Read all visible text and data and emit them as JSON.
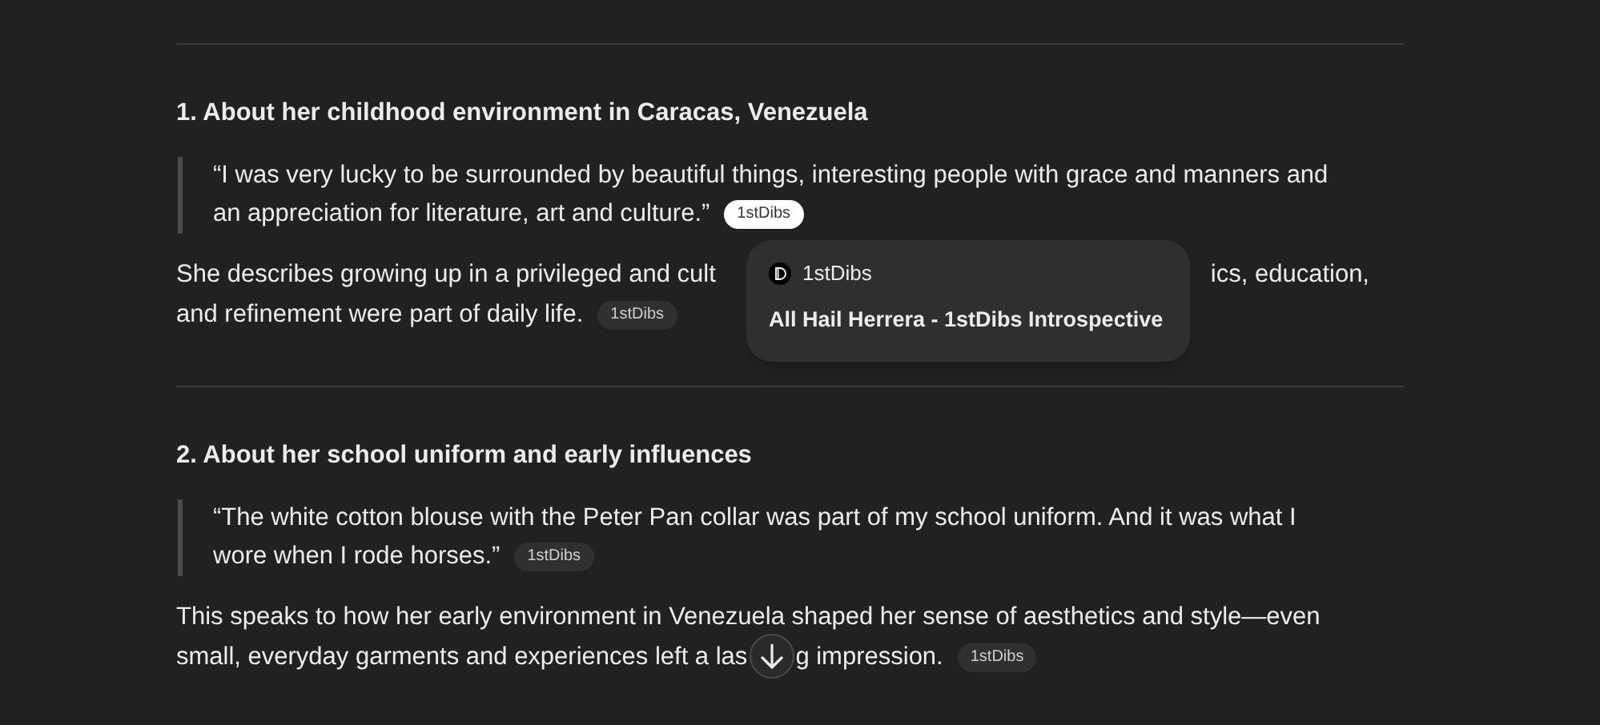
{
  "sections": [
    {
      "heading": "1. About her childhood environment in Caracas, Venezuela",
      "quote": {
        "lines": [
          "“I was very lucky to be surrounded by beautiful things, interesting people with grace and manners and",
          "an appreciation for literature, art and culture.”"
        ],
        "badge": {
          "label": "1stDibs",
          "selected": true
        }
      },
      "paragraph": {
        "lines": [
          [
            "She describes growing up in a privileged and cult",
            "ics, education,"
          ],
          [
            "and refinement were part of daily life."
          ]
        ],
        "badge": {
          "label": "1stDibs",
          "selected": false
        }
      },
      "popover": {
        "source": "1stDibs",
        "title": "All Hail Herrera - 1stDibs Introspective"
      }
    },
    {
      "heading": "2. About her school uniform and early influences",
      "quote": {
        "lines": [
          "“The white cotton blouse with the Peter Pan collar was part of my school uniform. And it was what I",
          "wore when I rode horses.”"
        ],
        "badge": {
          "label": "1stDibs",
          "selected": false
        }
      },
      "paragraph": {
        "lines": [
          [
            "This speaks to how her early environment in Venezuela shaped her sense of aesthetics and style—even"
          ],
          [
            "small, everyday garments and experiences left a las",
            "g impression."
          ]
        ],
        "badge": {
          "label": "1stDibs",
          "selected": false
        }
      }
    }
  ]
}
